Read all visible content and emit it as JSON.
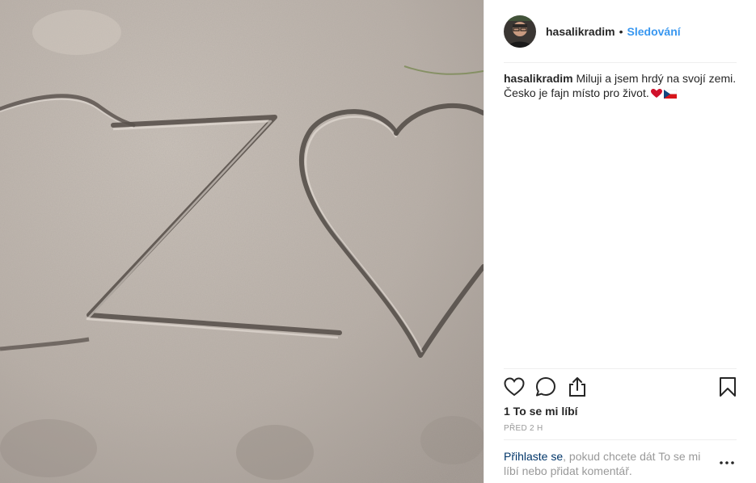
{
  "post": {
    "username": "hasalikradim",
    "dot": "•",
    "follow_label": "Sledování",
    "caption": {
      "username": "hasalikradim",
      "text": "Miluji a jsem hrdý na svojí zemi. Česko je fajn místo pro život.",
      "emojis": [
        "red-heart",
        "czech-flag"
      ]
    },
    "likes": "1 To se mi líbí",
    "timestamp": "PŘED 2 H",
    "login_prompt": {
      "link": "Přihlaste se",
      "text": ", pokud chcete dát To se mi líbí nebo přidat komentář."
    }
  },
  "colors": {
    "link": "#3897f0",
    "login_link": "#003569",
    "muted": "#999999",
    "sand": "#b7aea6"
  },
  "icons": [
    "heart-icon",
    "comment-icon",
    "share-icon",
    "bookmark-icon",
    "more-icon"
  ]
}
